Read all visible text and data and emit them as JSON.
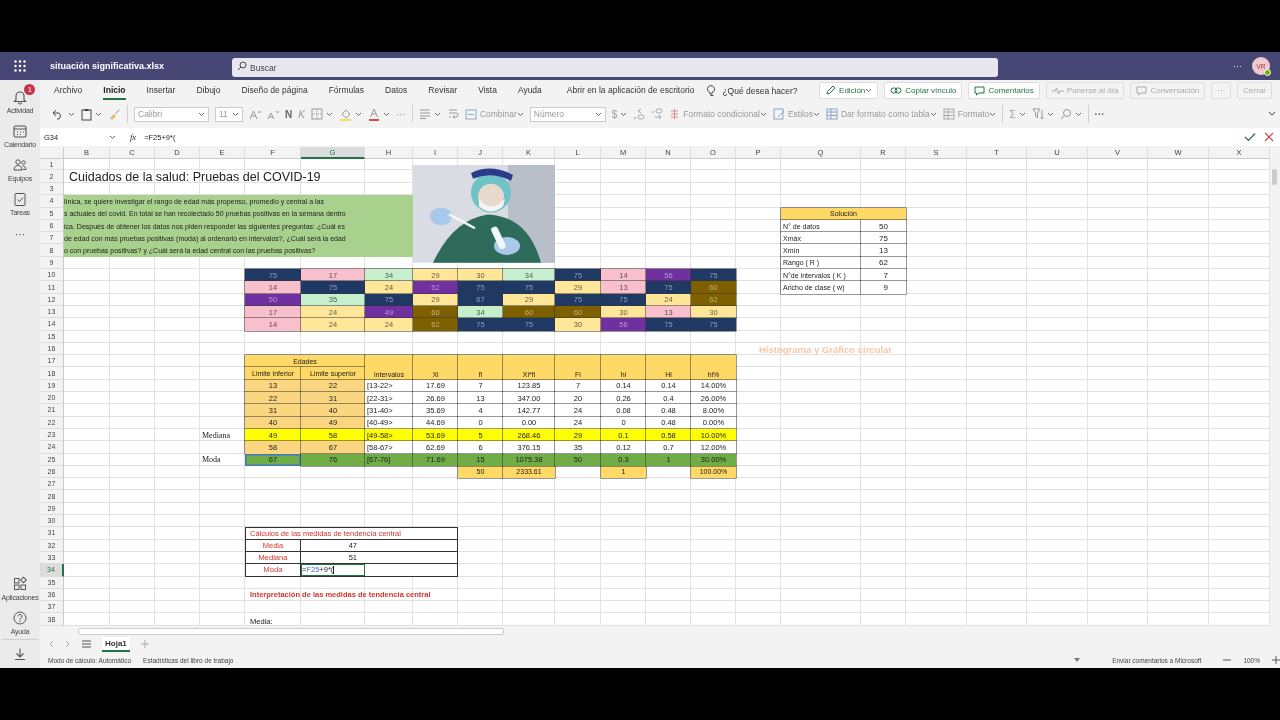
{
  "app": {
    "title": "situación significativa.xlsx",
    "search_placeholder": "Buscar",
    "more": "···",
    "avatar": "VR"
  },
  "rail": {
    "top": [
      {
        "kind": "activity",
        "label": "Actividad",
        "badge": "1"
      },
      {
        "kind": "calendar",
        "label": "Calendario"
      },
      {
        "kind": "teams",
        "label": "Equipos"
      },
      {
        "kind": "tasks",
        "label": "Tareas"
      },
      {
        "kind": "more",
        "label": "···"
      }
    ],
    "bottom": [
      {
        "kind": "apps",
        "label": "Aplicaciones"
      },
      {
        "kind": "help",
        "label": "Ayuda"
      },
      {
        "kind": "download"
      }
    ]
  },
  "menu_tabs": [
    {
      "label": "Archivo",
      "selected": false
    },
    {
      "label": "Inicio",
      "selected": true
    },
    {
      "label": "Insertar",
      "selected": false
    },
    {
      "label": "Dibujo",
      "selected": false
    },
    {
      "label": "Diseño de página",
      "selected": false
    },
    {
      "label": "Fórmulas",
      "selected": false
    },
    {
      "label": "Datos",
      "selected": false
    },
    {
      "label": "Revisar",
      "selected": false
    },
    {
      "label": "Vista",
      "selected": false
    },
    {
      "label": "Ayuda",
      "selected": false
    },
    {
      "label": "Abrir en la aplicación de escritorio",
      "selected": false
    }
  ],
  "tell_me": "¿Qué desea hacer?",
  "actions": [
    {
      "kind": "edit",
      "label": "Edición",
      "disabled": false
    },
    {
      "kind": "link",
      "label": "Copiar vínculo",
      "disabled": false
    },
    {
      "kind": "comments",
      "label": "Comentarios",
      "disabled": false
    },
    {
      "kind": "catchup",
      "label": "Ponerse al día",
      "disabled": true
    },
    {
      "kind": "chat",
      "label": "Conversación",
      "disabled": true
    },
    {
      "kind": "more",
      "label": "···",
      "disabled": true
    },
    {
      "kind": "close",
      "label": "Cerrar",
      "disabled": true
    }
  ],
  "toolbar": {
    "font": "Calibri",
    "size": "11",
    "bold": "N",
    "italic": "K",
    "more": "···",
    "merge": "Combinar",
    "number_format": "Número",
    "currency": "$",
    "conditional": "Formato condicional",
    "styles": "Estilos",
    "table_format": "Dar formato como tabla",
    "format": "Formato",
    "sum": "Σ",
    "overflow": "···"
  },
  "formula_bar": {
    "name_box": "G34",
    "function_label": "fx",
    "formula": "=F25+9*("
  },
  "sheet": {
    "columns": [
      {
        "label": "B",
        "selected": false
      },
      {
        "label": "C",
        "selected": false
      },
      {
        "label": "D",
        "selected": false
      },
      {
        "label": "E",
        "selected": false
      },
      {
        "label": "F",
        "selected": false
      },
      {
        "label": "G",
        "selected": true
      },
      {
        "label": "H",
        "selected": false
      },
      {
        "label": "I",
        "selected": false
      },
      {
        "label": "J",
        "selected": false
      },
      {
        "label": "K",
        "selected": false
      },
      {
        "label": "L",
        "selected": false
      },
      {
        "label": "M",
        "selected": false
      },
      {
        "label": "N",
        "selected": false
      },
      {
        "label": "O",
        "selected": false
      },
      {
        "label": "P",
        "selected": false
      },
      {
        "label": "Q",
        "selected": false
      },
      {
        "label": "R",
        "selected": false
      },
      {
        "label": "S",
        "selected": false
      },
      {
        "label": "T",
        "selected": false
      },
      {
        "label": "U",
        "selected": false
      },
      {
        "label": "V",
        "selected": false
      },
      {
        "label": "W",
        "selected": false
      },
      {
        "label": "X",
        "selected": false
      }
    ],
    "rows": [
      {
        "label": "1",
        "selected": false
      },
      {
        "label": "2",
        "selected": false
      },
      {
        "label": "3",
        "selected": false
      },
      {
        "label": "4",
        "selected": false
      },
      {
        "label": "5",
        "selected": false
      },
      {
        "label": "6",
        "selected": false
      },
      {
        "label": "7",
        "selected": false
      },
      {
        "label": "8",
        "selected": false
      },
      {
        "label": "9",
        "selected": false
      },
      {
        "label": "10",
        "selected": false
      },
      {
        "label": "11",
        "selected": false
      },
      {
        "label": "12",
        "selected": false
      },
      {
        "label": "13",
        "selected": false
      },
      {
        "label": "14",
        "selected": false
      },
      {
        "label": "15",
        "selected": false
      },
      {
        "label": "16",
        "selected": false
      },
      {
        "label": "17",
        "selected": false
      },
      {
        "label": "18",
        "selected": false
      },
      {
        "label": "19",
        "selected": false
      },
      {
        "label": "20",
        "selected": false
      },
      {
        "label": "21",
        "selected": false
      },
      {
        "label": "22",
        "selected": false
      },
      {
        "label": "23",
        "selected": false
      },
      {
        "label": "24",
        "selected": false
      },
      {
        "label": "25",
        "selected": false
      },
      {
        "label": "26",
        "selected": false
      },
      {
        "label": "27",
        "selected": false
      },
      {
        "label": "28",
        "selected": false
      },
      {
        "label": "29",
        "selected": false
      },
      {
        "label": "30",
        "selected": false
      },
      {
        "label": "31",
        "selected": false
      },
      {
        "label": "32",
        "selected": false
      },
      {
        "label": "33",
        "selected": false
      },
      {
        "label": "34",
        "selected": true
      },
      {
        "label": "35",
        "selected": false
      },
      {
        "label": "36",
        "selected": false
      },
      {
        "label": "37",
        "selected": false
      },
      {
        "label": "38",
        "selected": false
      }
    ],
    "title": "Cuidados de la salud: Pruebas del COVID-19",
    "intro_lines": [
      "línica, se quiere investigar el  rango de edad más propenso, promedio y central a las",
      "s actuales del covid. En total se han recolectado 50 pruebas positivas en la semana dentro",
      "ica. Después de obtener los datos nos piden responder las siguientes preguntas: ¿Cuál es",
      "de edad con más pruebas positivas (moda) al ordenarlo en intervalos?, ¿Cuál será  la edad",
      "o con pruebas positivas?  y ¿Cuál será la edad central con las pruebas positivas?"
    ],
    "picture": {
      "kind": "picture"
    },
    "color_grid": [
      {
        "cells": [
          {
            "value": "75",
            "color": "#203864"
          },
          {
            "value": "17",
            "color": "#f8c0cc"
          },
          {
            "value": "34",
            "color": "#c6efce"
          },
          {
            "value": "29",
            "color": "#ffe699"
          },
          {
            "value": "30",
            "color": "#ffe699"
          },
          {
            "value": "34",
            "color": "#c6efce"
          },
          {
            "value": "75",
            "color": "#203864"
          },
          {
            "value": "14",
            "color": "#f8c0cc"
          },
          {
            "value": "56",
            "color": "#7030a0"
          },
          {
            "value": "75",
            "color": "#203864"
          }
        ]
      },
      {
        "cells": [
          {
            "value": "14",
            "color": "#f8c0cc"
          },
          {
            "value": "75",
            "color": "#203864"
          },
          {
            "value": "24",
            "color": "#ffe699"
          },
          {
            "value": "52",
            "color": "#7030a0"
          },
          {
            "value": "75",
            "color": "#203864"
          },
          {
            "value": "75",
            "color": "#203864"
          },
          {
            "value": "29",
            "color": "#ffe699"
          },
          {
            "value": "13",
            "color": "#f8c0cc"
          },
          {
            "value": "75",
            "color": "#203864"
          },
          {
            "value": "60",
            "color": "#7f6000"
          }
        ]
      },
      {
        "cells": [
          {
            "value": "50",
            "color": "#7030a0"
          },
          {
            "value": "35",
            "color": "#c6efce"
          },
          {
            "value": "75",
            "color": "#203864"
          },
          {
            "value": "29",
            "color": "#ffe699"
          },
          {
            "value": "67",
            "color": "#203864"
          },
          {
            "value": "29",
            "color": "#ffe699"
          },
          {
            "value": "75",
            "color": "#203864"
          },
          {
            "value": "75",
            "color": "#203864"
          },
          {
            "value": "24",
            "color": "#ffe699"
          },
          {
            "value": "62",
            "color": "#7f6000"
          }
        ]
      },
      {
        "cells": [
          {
            "value": "17",
            "color": "#f8c0cc"
          },
          {
            "value": "24",
            "color": "#ffe699"
          },
          {
            "value": "49",
            "color": "#7030a0"
          },
          {
            "value": "60",
            "color": "#7f6000"
          },
          {
            "value": "34",
            "color": "#c6efce"
          },
          {
            "value": "60",
            "color": "#7f6000"
          },
          {
            "value": "60",
            "color": "#7f6000"
          },
          {
            "value": "30",
            "color": "#ffe699"
          },
          {
            "value": "13",
            "color": "#f8c0cc"
          },
          {
            "value": "30",
            "color": "#ffe699"
          }
        ]
      },
      {
        "cells": [
          {
            "value": "14",
            "color": "#f8c0cc"
          },
          {
            "value": "24",
            "color": "#ffe699"
          },
          {
            "value": "24",
            "color": "#ffe699"
          },
          {
            "value": "62",
            "color": "#7f6000"
          },
          {
            "value": "75",
            "color": "#203864"
          },
          {
            "value": "75",
            "color": "#203864"
          },
          {
            "value": "30",
            "color": "#ffe699"
          },
          {
            "value": "56",
            "color": "#7030a0"
          },
          {
            "value": "75",
            "color": "#203864"
          },
          {
            "value": "75",
            "color": "#203864"
          }
        ]
      }
    ],
    "chart_heading": "Histograma y Gráfico circular",
    "solution": {
      "title": "Solución",
      "rows": [
        {
          "label": "N° de datos",
          "value": "50"
        },
        {
          "label": "Xmáx",
          "value": "75"
        },
        {
          "label": "Xmín",
          "value": "13"
        },
        {
          "label": "Rango ( R )",
          "value": "62"
        },
        {
          "label": "N°de intervalos ( K )",
          "value": "7"
        },
        {
          "label": "Ancho de clase ( w)",
          "value": "9"
        }
      ]
    },
    "frequency_table": {
      "group_header": "Edades",
      "columns": [
        {
          "label": "Limite inferior"
        },
        {
          "label": "Limite superior"
        },
        {
          "label": "intervalos"
        },
        {
          "label": "Xi"
        },
        {
          "label": "fi",
          "total": "50"
        },
        {
          "label": "Xi*fi",
          "total": "2333.61"
        },
        {
          "label": "Fi"
        },
        {
          "label": "hi",
          "total": "1"
        },
        {
          "label": "Hi"
        },
        {
          "label": "hi%",
          "total": "100.00%"
        }
      ],
      "rows": [
        {
          "cells": [
            "13",
            "22",
            "[13-22>",
            "17.69",
            "7",
            "123.85",
            "7",
            "0.14",
            "0.14",
            "14.00%"
          ],
          "referenced": false
        },
        {
          "cells": [
            "22",
            "31",
            "[22-31>",
            "26.69",
            "13",
            "347.00",
            "20",
            "0.26",
            "0.4",
            "26.00%"
          ],
          "referenced": false
        },
        {
          "cells": [
            "31",
            "40",
            "[31-40>",
            "35.69",
            "4",
            "142.77",
            "24",
            "0.08",
            "0.48",
            "8.00%"
          ],
          "referenced": false
        },
        {
          "cells": [
            "40",
            "49",
            "[40-49>",
            "44.69",
            "0",
            "0.00",
            "24",
            "0",
            "0.48",
            "0.00%"
          ],
          "referenced": false
        },
        {
          "label": "Mediana",
          "color": "#ffff00",
          "cells": [
            "49",
            "58",
            "[49-58>",
            "53.69",
            "5",
            "268.46",
            "29",
            "0.1",
            "0.58",
            "10.00%"
          ],
          "referenced": false
        },
        {
          "cells": [
            "58",
            "67",
            "[58-67>",
            "62.69",
            "6",
            "376.15",
            "35",
            "0.12",
            "0.7",
            "12.00%"
          ],
          "referenced": false
        },
        {
          "label": "Moda",
          "color": "#70ad47",
          "cells": [
            "67",
            "76",
            "[67-76]",
            "71.69",
            "15",
            "1075.38",
            "50",
            "0.3",
            "1",
            "30.00%"
          ],
          "referenced": true
        }
      ]
    },
    "central_tendency": {
      "title": "Cálculos de las medidas de tendencia central",
      "rows": [
        {
          "kind": "value",
          "label": "Media",
          "value": "47"
        },
        {
          "kind": "value",
          "label": "Mediana",
          "value": "51"
        },
        {
          "kind": "editing",
          "label": "Moda",
          "formula": {
            "prefix": "=",
            "reference": "F25",
            "rest": "+9*("
          }
        }
      ]
    },
    "interpretation_heading": "Interpretación de las  medidas de tendencia central",
    "media_label": "Media:"
  },
  "sheet_tabs": [
    {
      "label": "Hoja1",
      "selected": true
    }
  ],
  "status_bar": {
    "calc_mode": "Modo de cálculo: Automático",
    "stats": "Estadísticas del libro de trabajo",
    "feedback": "Enviar comentarios a Microsoft",
    "zoom": "100%"
  }
}
